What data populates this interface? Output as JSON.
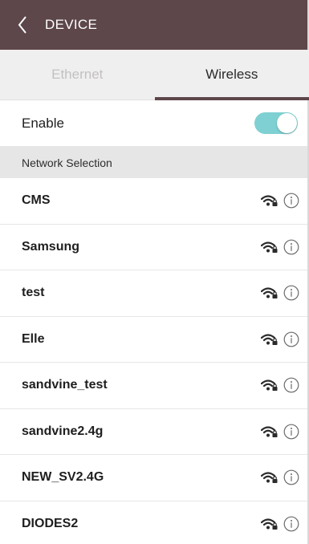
{
  "header": {
    "title": "DEVICE"
  },
  "tabs": [
    {
      "label": "Ethernet",
      "active": false
    },
    {
      "label": "Wireless",
      "active": true
    }
  ],
  "enable": {
    "label": "Enable",
    "on": true
  },
  "section": {
    "label": "Network Selection"
  },
  "networks": [
    {
      "name": "CMS"
    },
    {
      "name": "Samsung"
    },
    {
      "name": "test"
    },
    {
      "name": "Elle"
    },
    {
      "name": "sandvine_test"
    },
    {
      "name": "sandvine2.4g"
    },
    {
      "name": "NEW_SV2.4G"
    },
    {
      "name": "DIODES2"
    }
  ],
  "icons": {
    "back": "chevron-left-icon",
    "wifi": "wifi-lock-icon",
    "info": "info-icon"
  },
  "colors": {
    "header": "#5d474b",
    "toggle_on": "#7fd0d2",
    "tab_indicator": "#5d474b"
  }
}
